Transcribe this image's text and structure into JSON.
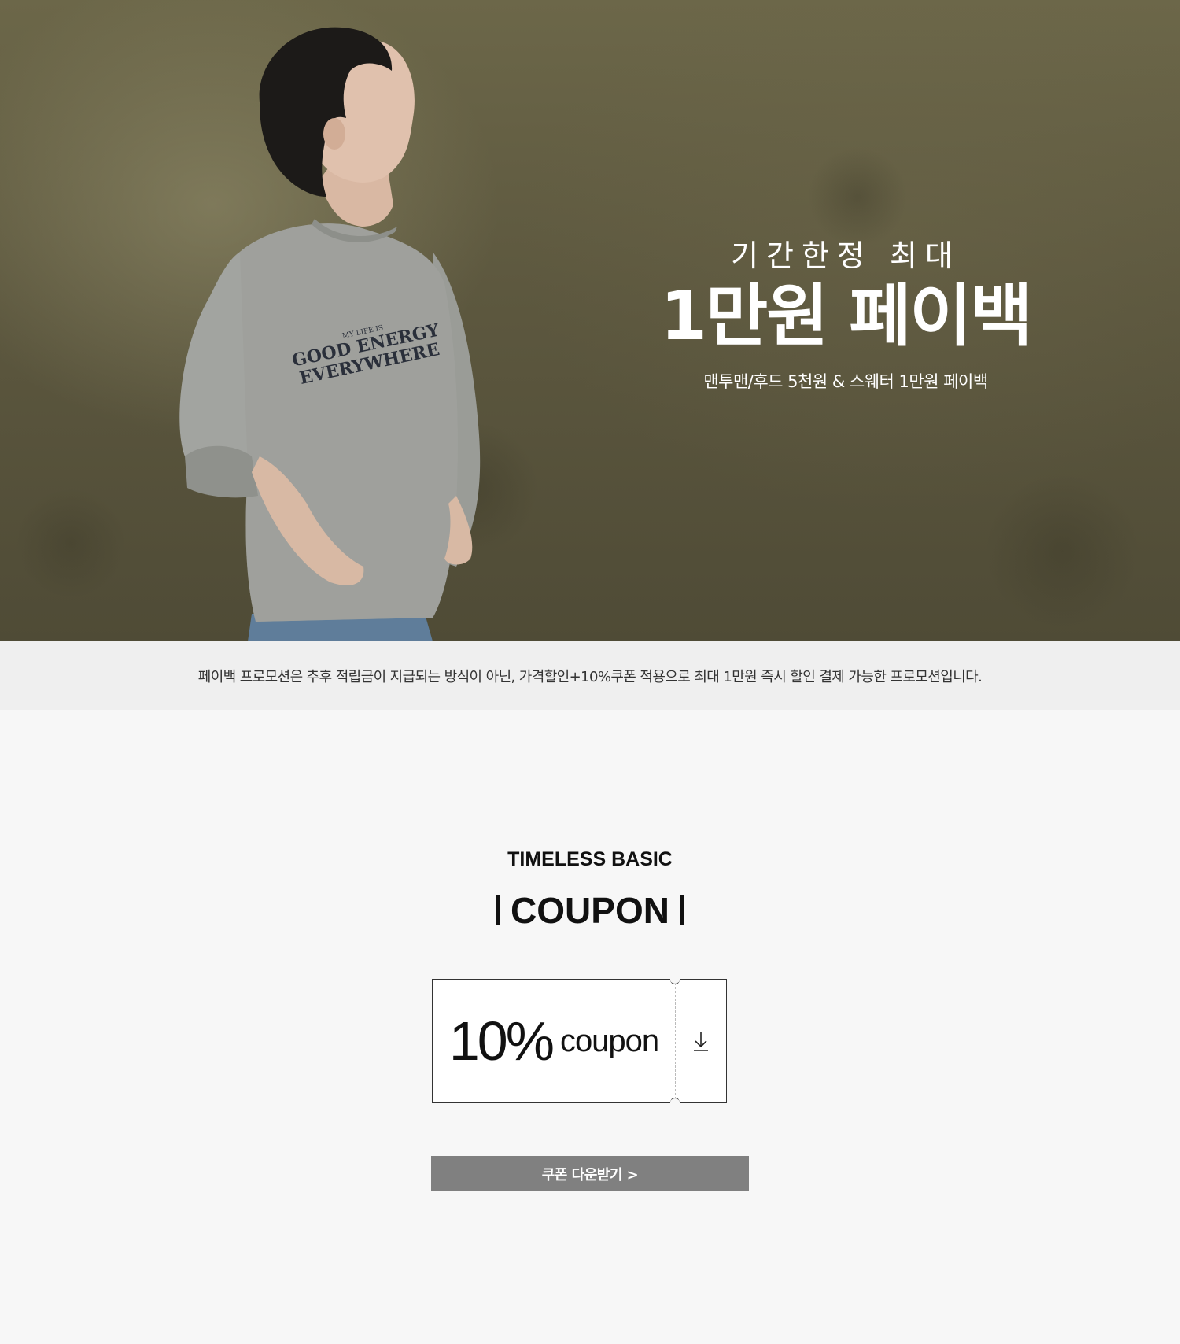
{
  "hero": {
    "kicker": "기간한정 최대",
    "headline": "1만원 페이백",
    "subtitle": "맨투맨/후드 5천원 & 스웨터 1만원 페이백",
    "shirt_print": [
      "MY LIFE IS",
      "GOOD ENERGY",
      "EVERYWHERE"
    ]
  },
  "notice": {
    "text": "페이백 프로모션은 추후 적립금이 지급되는 방식이 아닌, 가격할인+10%쿠폰 적용으로 최대 1만원 즉시 할인 결제 가능한 프로모션입니다."
  },
  "coupon_section": {
    "kicker": "TIMELESS BASIC",
    "title": "COUPON",
    "coupon": {
      "value": "10%",
      "unit": "coupon",
      "download_icon": "download-arrow-icon"
    },
    "download_button": "쿠폰 다운받기 >"
  },
  "colors": {
    "hero_bg": "#5d583f",
    "notice_bg": "#efefef",
    "section_bg": "#f7f7f7",
    "button_bg": "#808080"
  }
}
